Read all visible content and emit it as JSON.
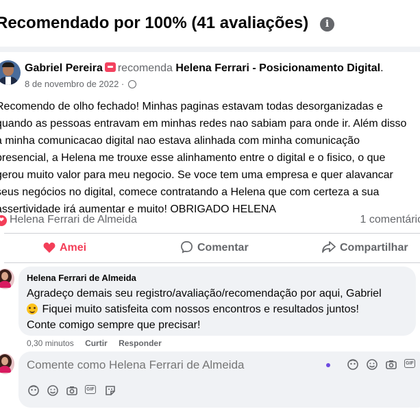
{
  "header": {
    "title": "Recomendado por 100% (41 avaliações)",
    "info_icon": "info-icon"
  },
  "post": {
    "author": "Gabriel Pereira",
    "verb": "recomenda",
    "page": "Helena Ferrari - Posicionamento Digital",
    "period": ".",
    "date": "8 de novembro de 2022 ·",
    "text_lines": [
      "Recomendo de olho fechado! Minhas paginas estavam todas desorganizadas e",
      "quando as pessoas entravam em minhas redes nao sabiam para onde ir. Além disso",
      "a minha comunicacao digital nao estava alinhada com minha comunicação",
      "presencial, a Helena me trouxe esse alinhamento entre o digital e o fisico, o que",
      "gerou muito valor para meu negocio. Se voce tem uma empresa e quer alavancar",
      "seus negócios no digital, comece contratando a Helena que com certeza a sua",
      "assertividade irá aumentar e muito! OBRIGADO HELENA"
    ]
  },
  "reactions": {
    "reactor": "Helena Ferrari de Almeida",
    "comments": "1 comentário"
  },
  "actions": {
    "love": "Amei",
    "comment": "Comentar",
    "share": "Compartilhar"
  },
  "comment": {
    "author": "Helena Ferrari de Almeida",
    "line1": "Agradeço demais seu registro/avaliação/recomendação por aqui, Gabriel",
    "line2": "Fiquei muito satisfeita com nossos encontros e resultados juntos!",
    "line3": "Conte comigo sempre que precisar!",
    "time": "0,30 minutos",
    "like": "Curtir",
    "reply": "Responder"
  },
  "composer": {
    "placeholder": "Comente como Helena Ferrari de Almeida",
    "gif_label": "GIF",
    "tools": [
      "avatar-sticker-icon",
      "emoji-icon",
      "camera-icon",
      "gif-icon",
      "sticker-icon"
    ]
  },
  "colors": {
    "love": "#f33e58",
    "muted": "#65676b",
    "bg": "#f0f2f5"
  }
}
